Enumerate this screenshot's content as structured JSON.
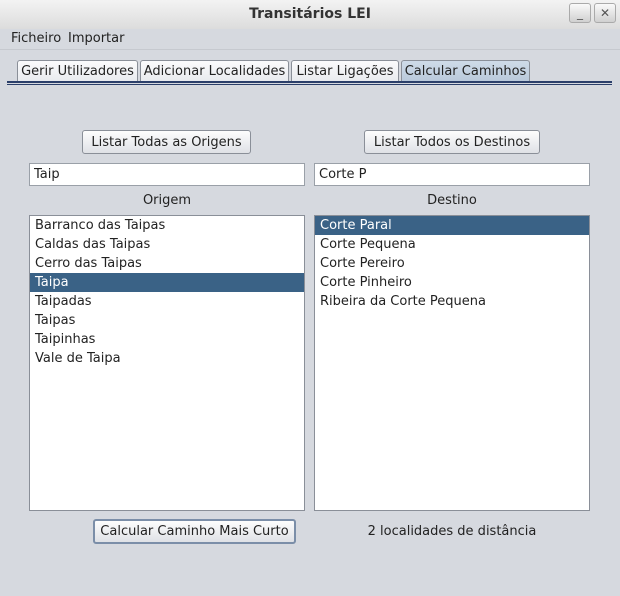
{
  "window": {
    "title": "Transitários LEI",
    "minimize_label": "_",
    "close_label": "✕"
  },
  "menu": [
    "Ficheiro",
    "Importar"
  ],
  "tabs": [
    {
      "label": "Gerir Utilizadores",
      "active": false
    },
    {
      "label": "Adicionar Localidades",
      "active": false
    },
    {
      "label": "Listar Ligações",
      "active": false
    },
    {
      "label": "Calcular Caminhos",
      "active": true
    }
  ],
  "origin": {
    "list_all_button": "Listar Todas as Origens",
    "search_value": "Taip",
    "label": "Origem",
    "items": [
      "Barranco das Taipas",
      "Caldas das Taipas",
      "Cerro das Taipas",
      "Taipa",
      "Taipadas",
      "Taipas",
      "Taipinhas",
      "Vale de Taipa"
    ],
    "selected": "Taipa"
  },
  "destination": {
    "list_all_button": "Listar Todos os Destinos",
    "search_value": "Corte P",
    "label": "Destino",
    "items": [
      "Corte Paral",
      "Corte Pequena",
      "Corte Pereiro",
      "Corte Pinheiro",
      "Ribeira da Corte Pequena"
    ],
    "selected": "Corte Paral"
  },
  "footer": {
    "calculate_button": "Calcular Caminho Mais Curto",
    "result": "2 localidades de distância"
  },
  "colors": {
    "selection": "#3a6286",
    "background": "#d6d9df",
    "tab_active": "#b8c8da"
  }
}
